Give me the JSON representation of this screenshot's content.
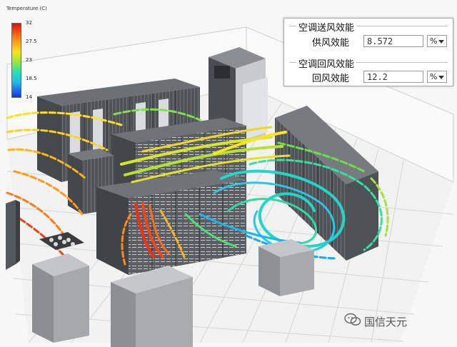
{
  "legend": {
    "title": "Temperature (C)",
    "ticks": [
      "32",
      "27.5",
      "23",
      "18.5",
      "14"
    ]
  },
  "panel": {
    "supply_group": {
      "title": "空调送风效能",
      "label": "供风效能",
      "value": "8.572",
      "unit": "%"
    },
    "return_group": {
      "title": "空调回风效能",
      "label": "回风效能",
      "value": "12.2",
      "unit": "%"
    }
  },
  "watermark": {
    "text": "国信天元",
    "icon": "wechat-icon"
  },
  "colors": {
    "hot": "#e11010",
    "warm": "#ffb31a",
    "mid": "#95e83a",
    "cool": "#23e3b0",
    "cold": "#1530e8",
    "rack": "#56595e"
  }
}
